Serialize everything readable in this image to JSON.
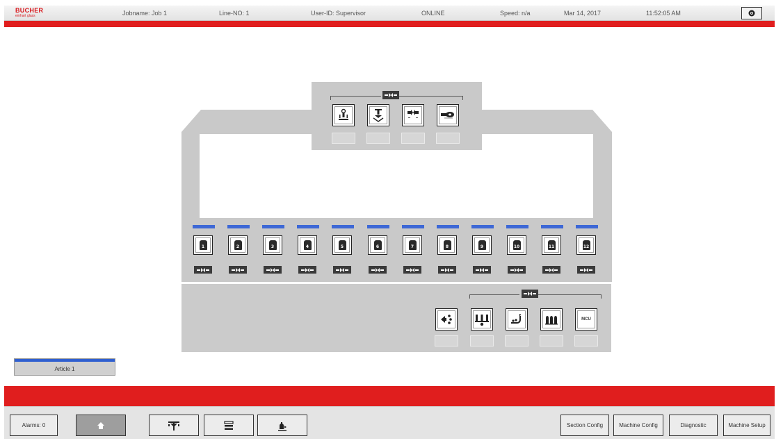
{
  "header": {
    "logo_brand": "BUCHER",
    "logo_sub": "emhart glass",
    "jobname": "Jobname: Job 1",
    "line_no": "Line-NO: 1",
    "user_id": "User-ID: Supervisor",
    "status": "ONLINE",
    "speed": "Speed: n/a",
    "date": "Mar 14, 2017",
    "time": "11:52:05 AM",
    "settings_icon": "gear-icon"
  },
  "top_unit": {
    "control_icon": "left-right-arrows-icon",
    "buttons": [
      {
        "icon": "gob-distributor-icon"
      },
      {
        "icon": "shear-icon"
      },
      {
        "icon": "delivery-icon"
      },
      {
        "icon": "feeder-icon"
      }
    ]
  },
  "sections": {
    "labels": [
      "1",
      "2",
      "3",
      "4",
      "5",
      "6",
      "7",
      "8",
      "9",
      "10",
      "11",
      "12"
    ],
    "control_icon": "left-right-arrows-icon",
    "indicator_color": "#3d68d6"
  },
  "bottom_unit": {
    "control_icon": "left-right-arrows-icon",
    "buttons": [
      {
        "icon": "pusher-icon",
        "label": ""
      },
      {
        "icon": "mold-cooling-icon",
        "label": ""
      },
      {
        "icon": "conveyor-icon",
        "label": ""
      },
      {
        "icon": "bottles-icon",
        "label": ""
      },
      {
        "icon": "mcu-icon",
        "label": "MCU"
      }
    ]
  },
  "article": {
    "label": "Article 1"
  },
  "footer": {
    "alarms_label": "Alarms: 0",
    "nav_icons": [
      "home-icon",
      "timing-icon",
      "settings-list-icon",
      "bottle-weight-icon"
    ],
    "section_config": "Section Config",
    "machine_config": "Machine Config",
    "diagnostic": "Diagnostic",
    "machine_setup": "Machine Setup"
  },
  "colors": {
    "brand_red": "#e01e1e",
    "section_blue": "#3d68d6",
    "panel_gray": "#c9c9c9"
  }
}
